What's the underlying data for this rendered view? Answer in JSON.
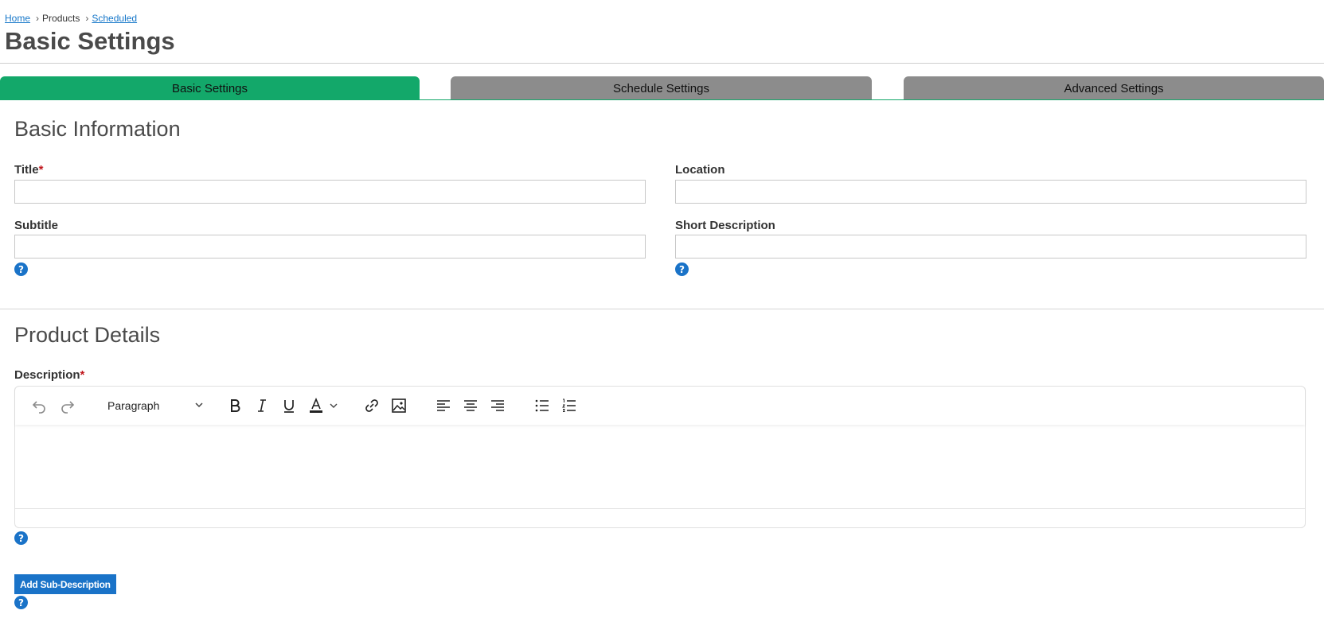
{
  "breadcrumb": {
    "home": "Home",
    "products": "Products",
    "scheduled": "Scheduled",
    "separator": ">"
  },
  "page": {
    "title": "Basic Settings"
  },
  "tabs": [
    {
      "label": "Basic Settings",
      "active": true
    },
    {
      "label": "Schedule Settings",
      "active": false
    },
    {
      "label": "Advanced Settings",
      "active": false
    }
  ],
  "basic_info": {
    "heading": "Basic Information",
    "title_label": "Title",
    "required_mark": "*",
    "title_value": "",
    "location_label": "Location",
    "location_value": "",
    "subtitle_label": "Subtitle",
    "subtitle_value": "",
    "short_description_label": "Short Description",
    "short_description_value": ""
  },
  "product_details": {
    "heading": "Product Details",
    "description_label": "Description",
    "required_mark": "*",
    "editor": {
      "format": "Paragraph",
      "content": ""
    }
  },
  "help_icon_glyph": "?",
  "add_sub_description_label": "Add Sub-Description",
  "colors": {
    "accent_green": "#13a86a",
    "inactive_tab": "#8c8c8c",
    "link_blue": "#1677c9",
    "button_blue": "#1a73c8",
    "required_red": "#c0161c"
  }
}
